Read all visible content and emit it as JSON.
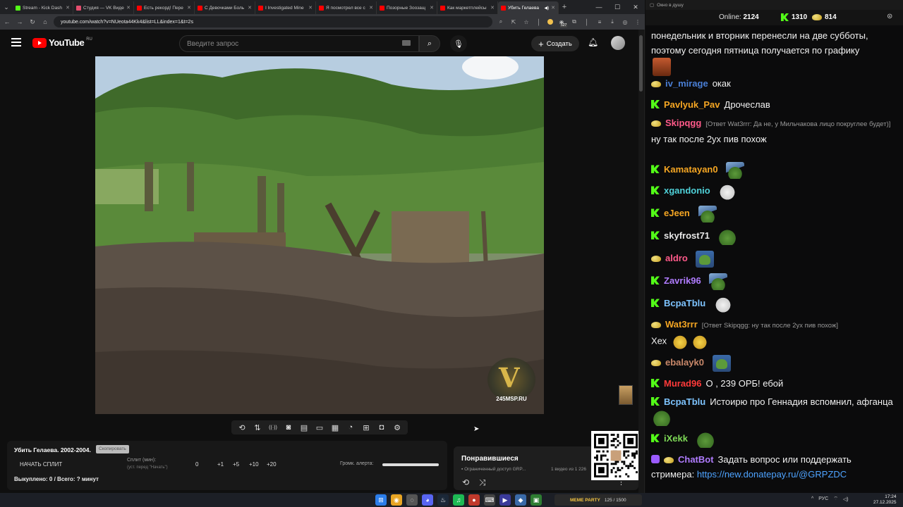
{
  "browser": {
    "tabs": [
      {
        "title": "Stream - Kick Dash",
        "color": "#53fc18"
      },
      {
        "title": "Студия — VK Видео",
        "color": "#e34d6d"
      },
      {
        "title": "Есть рекорд! Пере",
        "color": "#ff0000"
      },
      {
        "title": "С Девочками Боль",
        "color": "#ff0000"
      },
      {
        "title": "I Investigated Mine",
        "color": "#ff0000"
      },
      {
        "title": "Я посмотрел все с",
        "color": "#ff0000"
      },
      {
        "title": "Позорные Зоозащ",
        "color": "#ff0000"
      },
      {
        "title": "Как маркетплейсы",
        "color": "#ff0000"
      },
      {
        "title": "Убить Гелаева",
        "color": "#ff0000",
        "active": true
      }
    ],
    "new_tab": "+",
    "url": "youtube.com/watch?v=NUeota44Kk4&list=LL&index=1&t=2s",
    "extension_badge": "527"
  },
  "youtube": {
    "logo_word": "YouTube",
    "country_code": "RU",
    "search_placeholder": "Введите запрос",
    "create_label": "Создать"
  },
  "video": {
    "watermark_text": "245MSP.RU"
  },
  "player_tools": [
    "loop-icon",
    "sort-icon",
    "broadcast-icon",
    "record-icon",
    "clapper-icon",
    "screen-icon",
    "film-icon",
    "speed-icon",
    "add-icon",
    "camera-icon",
    "gear-icon"
  ],
  "info_panel": {
    "title": "Убить Гелаева. 2002-2004.",
    "copy_label": "Скопировать",
    "start_split": "НАЧАТЬ СПЛИТ",
    "split_label": "Сплит (мин):",
    "split_hint": "(уст. перед \"Начать\")",
    "split_values": [
      "0",
      "+1",
      "+5",
      "+10",
      "+20"
    ],
    "alert_label": "Громк. алерта:",
    "alert_level": 1.0,
    "bought": "Выкуплено: 0 / Всего: ? минут"
  },
  "liked": {
    "title": "Понравившиеся",
    "access": "Ограниченный доступ  GRP...",
    "count": "1 видео из 1 226"
  },
  "chat": {
    "window_title": "Окно в душу",
    "online_label": "Online:",
    "online_value": "2124",
    "kick_count": "1310",
    "coin_count": "814",
    "messages": [
      {
        "badge": "none",
        "user": "",
        "user_color": "#fff",
        "reply": "",
        "text": "понедельник и вторник перенесли на две субботы, поэтому сегодня пятница получается по графику",
        "emote": "portrait"
      },
      {
        "badge": "coin",
        "user": "iv_mirage",
        "user_color": "#4a7fd6",
        "reply": "",
        "text": "окак",
        "emote": ""
      },
      {
        "badge": "kick",
        "user": "Pavlyuk_Pav",
        "user_color": "#f5a623",
        "reply": "",
        "text": "Дрочеслав",
        "emote": ""
      },
      {
        "badge": "coin",
        "user": "Skipqgg",
        "user_color": "#ff5a8a",
        "reply": "[Ответ Wat3rrr: Да не, у Мильчакова лицо покруглее будет)]",
        "text": "ну так после 2ух пив похож",
        "emote": ""
      },
      {
        "badge": "kick",
        "user": "Kamatayan0",
        "user_color": "#f5a623",
        "reply": "",
        "text": "",
        "emote": "pepe-hat"
      },
      {
        "badge": "kick",
        "user": "xgandonio",
        "user_color": "#4fd1d9",
        "reply": "",
        "text": "",
        "emote": "cat"
      },
      {
        "badge": "kick",
        "user": "eJeen",
        "user_color": "#f5a623",
        "reply": "",
        "text": "",
        "emote": "pepe-hat"
      },
      {
        "badge": "kick",
        "user": "skyfrost71",
        "user_color": "#e8e8e8",
        "reply": "",
        "text": "",
        "emote": "pepe"
      },
      {
        "badge": "coin",
        "user": "aldro",
        "user_color": "#ff5a8a",
        "reply": "",
        "text": "",
        "emote": "pepe-square"
      },
      {
        "badge": "kick",
        "user": "Zavrik96",
        "user_color": "#b07cff",
        "reply": "",
        "text": "",
        "emote": "pepe-hat"
      },
      {
        "badge": "kick",
        "user": "BcpaTblu",
        "user_color": "#7ec4ff",
        "reply": "",
        "text": "",
        "emote": "cat"
      },
      {
        "badge": "coin",
        "user": "Wat3rrr",
        "user_color": "#f5a623",
        "reply": "[Ответ Skipqgg: ну так после 2ух пив похож]",
        "text": "Хех",
        "emote": "face2"
      },
      {
        "badge": "coin",
        "user": "ebalayk0",
        "user_color": "#c9886a",
        "reply": "",
        "text": "",
        "emote": "pepe-square"
      },
      {
        "badge": "kick",
        "user": "Murad96",
        "user_color": "#ff3a3a",
        "reply": "",
        "text": "О , 239 ОРБ! ебой",
        "emote": ""
      },
      {
        "badge": "kick",
        "user": "BcpaTblu",
        "user_color": "#7ec4ff",
        "reply": "",
        "text": "Истоирю про Геннадия вспомнил, афганца",
        "emote": "pepe"
      },
      {
        "badge": "kick",
        "user": "iXekk",
        "user_color": "#7ed957",
        "reply": "",
        "text": "",
        "emote": "pepe"
      },
      {
        "badge": "bot",
        "user": "ChatBot",
        "user_color": "#b07cff",
        "reply": "",
        "text": "Задать вопрос или поддержать стримера:",
        "link": "https://new.donatepay.ru/@GRPZDC",
        "emote": ""
      }
    ]
  },
  "taskbar": {
    "meme_label": "MEME PARTY",
    "meme_progress": "125 / 1500",
    "language": "РУС",
    "time": "17:24",
    "date": "27.12.2025"
  }
}
